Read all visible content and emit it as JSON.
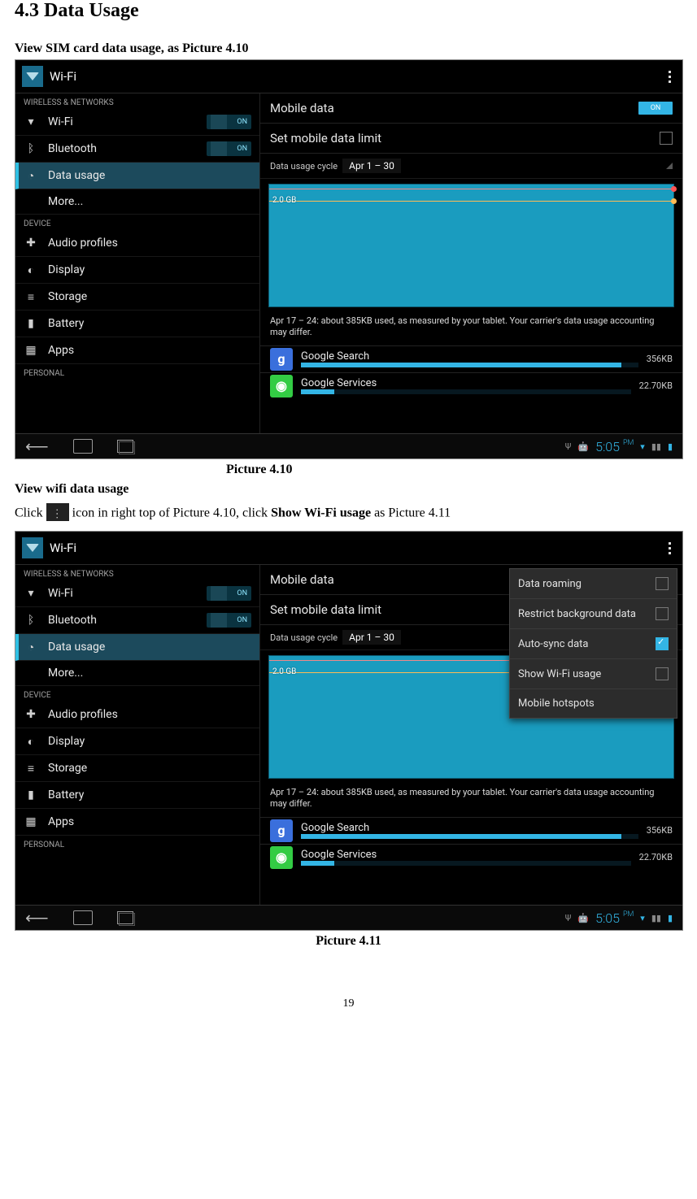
{
  "doc": {
    "section_title": "4.3 Data Usage",
    "line1": "View SIM card data usage, as Picture 4.10",
    "caption1": "Picture 4.10",
    "line2_head": "View wifi data usage",
    "line3_a": "Click ",
    "line3_b": " icon in right top of Picture 4.10, click ",
    "line3_bold": "Show Wi-Fi usage",
    "line3_c": " as Picture 4.11",
    "caption2": "Picture 4.11",
    "page_number": "19"
  },
  "shot": {
    "top_title": "Wi-Fi",
    "sidebar": {
      "group1": "WIRELESS & NETWORKS",
      "wifi": "Wi-Fi",
      "bluetooth": "Bluetooth",
      "data_usage": "Data usage",
      "more": "More...",
      "group2": "DEVICE",
      "audio": "Audio profiles",
      "display": "Display",
      "storage": "Storage",
      "battery": "Battery",
      "apps": "Apps",
      "group3": "PERSONAL",
      "toggle_on": "ON"
    },
    "right": {
      "mobile_data": "Mobile data",
      "set_limit": "Set mobile data limit",
      "cycle_label": "Data usage cycle",
      "cycle_value": "Apr 1 – 30",
      "chart_mark": "2.0 GB",
      "note": "Apr 17 – 24: about 385KB used, as measured by your tablet. Your carrier's data usage accounting may differ.",
      "app1": "Google Search",
      "app1_size": "356KB",
      "app2": "Google Services",
      "app2_size": "22.70KB",
      "on_label": "ON"
    },
    "nav": {
      "clock": "5:05",
      "ampm": "PM"
    },
    "popup": {
      "roaming": "Data roaming",
      "restrict": "Restrict background data",
      "autosync": "Auto-sync data",
      "show_wifi": "Show Wi-Fi usage",
      "hotspots": "Mobile hotspots"
    }
  }
}
